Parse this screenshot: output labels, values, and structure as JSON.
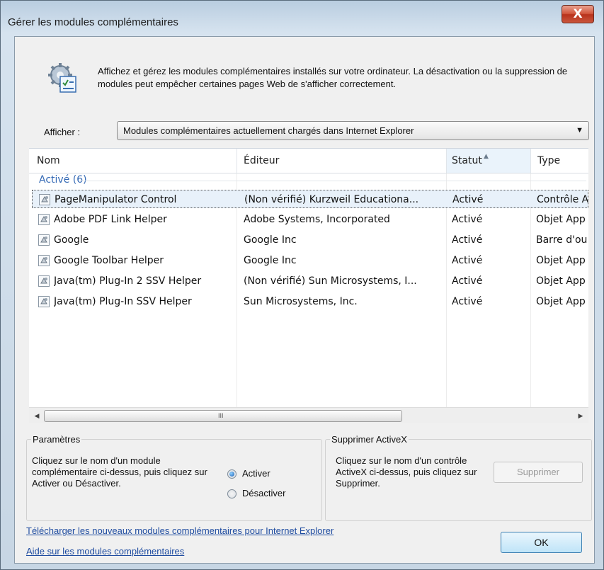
{
  "window": {
    "title": "Gérer les modules complémentaires",
    "close_label": "X"
  },
  "intro": {
    "text": "Affichez et gérez les modules complémentaires installés sur votre ordinateur. La désactivation ou la suppression de modules peut empêcher certaines pages Web de s'afficher correctement.",
    "icon": "addons-gear-icon"
  },
  "filter": {
    "label": "Afficher :",
    "selected": "Modules complémentaires actuellement chargés dans Internet Explorer"
  },
  "table": {
    "columns": [
      "Nom",
      "Éditeur",
      "Statut",
      "Type"
    ],
    "sorted_column": "Statut",
    "group": "Activé (6)",
    "rows": [
      {
        "name": "PageManipulator Control",
        "publisher": "(Non vérifié) Kurzweil Educationa...",
        "status": "Activé",
        "type": "Contrôle A"
      },
      {
        "name": "Adobe PDF Link Helper",
        "publisher": "Adobe Systems, Incorporated",
        "status": "Activé",
        "type": "Objet App"
      },
      {
        "name": "Google",
        "publisher": "Google Inc",
        "status": "Activé",
        "type": "Barre d'ou"
      },
      {
        "name": "Google Toolbar Helper",
        "publisher": "Google Inc",
        "status": "Activé",
        "type": "Objet App"
      },
      {
        "name": "Java(tm) Plug-In 2 SSV Helper",
        "publisher": "(Non vérifié) Sun Microsystems, I...",
        "status": "Activé",
        "type": "Objet App"
      },
      {
        "name": "Java(tm) Plug-In SSV Helper",
        "publisher": "Sun Microsystems, Inc.",
        "status": "Activé",
        "type": "Objet App"
      }
    ],
    "selected_row": 0,
    "scroll_grip": "III"
  },
  "settings": {
    "legend": "Paramètres",
    "text": "Cliquez sur le nom d'un module complémentaire ci-dessus, puis cliquez sur Activer ou Désactiver.",
    "enable_label": "Activer",
    "disable_label": "Désactiver",
    "selected": "enable"
  },
  "activex": {
    "legend": "Supprimer ActiveX",
    "text": "Cliquez sur le nom d'un contrôle ActiveX ci-dessus, puis cliquez sur Supprimer.",
    "remove_label": "Supprimer"
  },
  "links": {
    "download": "Télécharger les nouveaux modules complémentaires pour Internet Explorer",
    "help": "Aide sur les modules complémentaires"
  },
  "ok_label": "OK",
  "colors": {
    "link": "#1f4ca0",
    "group_header": "#3469b5",
    "close_button": "#c9462e"
  }
}
